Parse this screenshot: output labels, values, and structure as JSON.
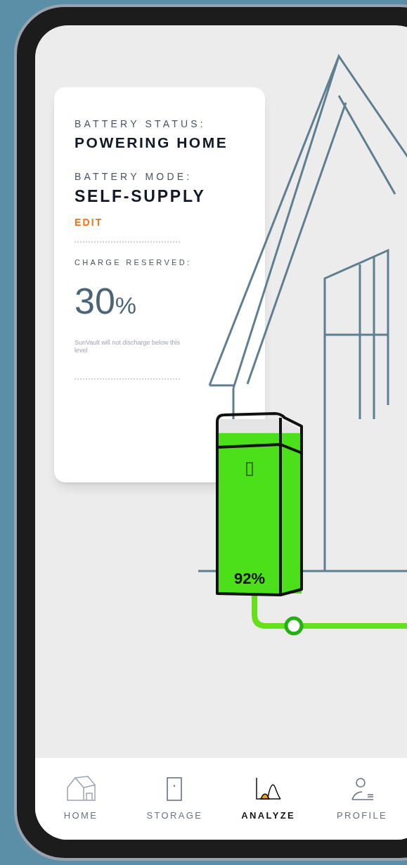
{
  "status_card": {
    "status_label": "BATTERY STATUS:",
    "status_value": "POWERING HOME",
    "mode_label": "BATTERY MODE:",
    "mode_value": "SELF-SUPPLY",
    "edit_link": "EDIT",
    "reserve_label": "CHARGE RESERVED:",
    "reserve_value": "30",
    "reserve_unit": "%",
    "note": "SunVault will not discharge below this level"
  },
  "battery": {
    "reading": "92%",
    "level": 0.92
  },
  "nav": [
    {
      "label": "HOME",
      "kind": "home",
      "selected": false
    },
    {
      "label": "STORAGE",
      "kind": "storage",
      "selected": false
    },
    {
      "label": "ANALYZE",
      "kind": "analyze",
      "selected": true
    },
    {
      "label": "PROFILE",
      "kind": "profile",
      "selected": false
    }
  ]
}
